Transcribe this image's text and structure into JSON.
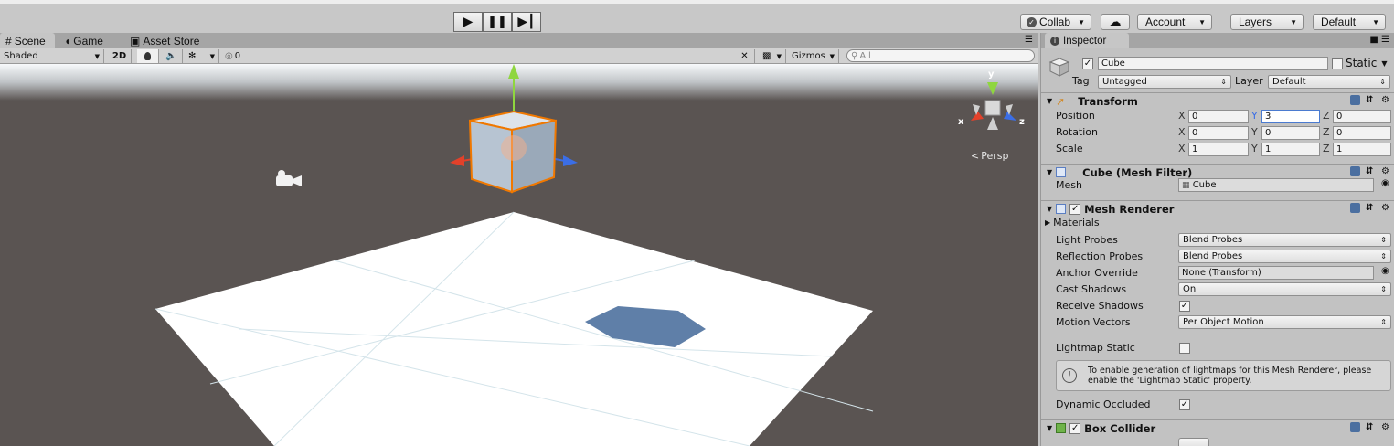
{
  "toolbar": {
    "play_icon": "play-icon",
    "pause_icon": "pause-icon",
    "step_icon": "step-icon",
    "collab_label": "Collab",
    "account_label": "Account",
    "layers_label": "Layers",
    "layout_label": "Default"
  },
  "tabs": {
    "scene": "Scene",
    "game": "Game",
    "asset_store": "Asset Store"
  },
  "scenebar": {
    "shading_mode": "Shaded",
    "mode_2d": "2D",
    "hidden_count": "0",
    "gizmos_label": "Gizmos",
    "search_placeholder": "All"
  },
  "viewport": {
    "persp_label": "Persp",
    "gizmo_axes": {
      "x": "x",
      "y": "y",
      "z": "z"
    },
    "colors": {
      "x_axis": "#e2412a",
      "y_axis": "#8fd63f",
      "z_axis": "#3b6ee6",
      "selection": "#f07800"
    }
  },
  "inspector": {
    "tab_label": "Inspector",
    "object": {
      "name": "Cube",
      "static_label": "Static",
      "tag_label": "Tag",
      "tag_value": "Untagged",
      "layer_label": "Layer",
      "layer_value": "Default"
    },
    "transform": {
      "title": "Transform",
      "position_label": "Position",
      "rotation_label": "Rotation",
      "scale_label": "Scale",
      "position": {
        "x": "0",
        "y": "3",
        "z": "0"
      },
      "rotation": {
        "x": "0",
        "y": "0",
        "z": "0"
      },
      "scale": {
        "x": "1",
        "y": "1",
        "z": "1"
      }
    },
    "mesh_filter": {
      "title": "Cube (Mesh Filter)",
      "mesh_label": "Mesh",
      "mesh_value": "Cube"
    },
    "mesh_renderer": {
      "title": "Mesh Renderer",
      "materials_label": "Materials",
      "light_probes_label": "Light Probes",
      "light_probes_value": "Blend Probes",
      "reflection_probes_label": "Reflection Probes",
      "reflection_probes_value": "Blend Probes",
      "anchor_override_label": "Anchor Override",
      "anchor_override_value": "None (Transform)",
      "cast_shadows_label": "Cast Shadows",
      "cast_shadows_value": "On",
      "receive_shadows_label": "Receive Shadows",
      "motion_vectors_label": "Motion Vectors",
      "motion_vectors_value": "Per Object Motion",
      "lightmap_static_label": "Lightmap Static",
      "help_text": "To enable generation of lightmaps for this Mesh Renderer, please enable the 'Lightmap Static' property.",
      "dynamic_occluded_label": "Dynamic Occluded"
    },
    "box_collider": {
      "title": "Box Collider"
    }
  }
}
